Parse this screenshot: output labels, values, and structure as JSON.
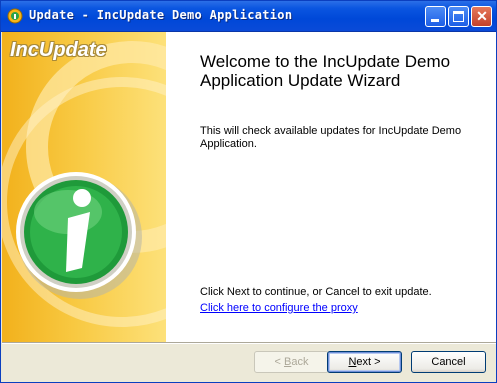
{
  "window": {
    "title": "Update - IncUpdate Demo Application"
  },
  "side_panel": {
    "brand": "IncUpdate"
  },
  "main": {
    "heading": "Welcome to the IncUpdate Demo Application Update Wizard",
    "description": "This will check available updates for IncUpdate Demo Application.",
    "continue_hint": "Click Next to continue, or Cancel to exit update.",
    "proxy_link": "Click here to configure the proxy"
  },
  "buttons": {
    "back": {
      "prefix": "< ",
      "mnemonic": "B",
      "rest": "ack",
      "enabled": false
    },
    "next": {
      "mnemonic": "N",
      "rest": "ext >",
      "enabled": true
    },
    "cancel": {
      "label": "Cancel",
      "enabled": true
    }
  },
  "colors": {
    "titlebar": "#0048d8",
    "side_panel": "#f8c942",
    "icon_green": "#1f9a3a",
    "link": "#0000ff"
  }
}
